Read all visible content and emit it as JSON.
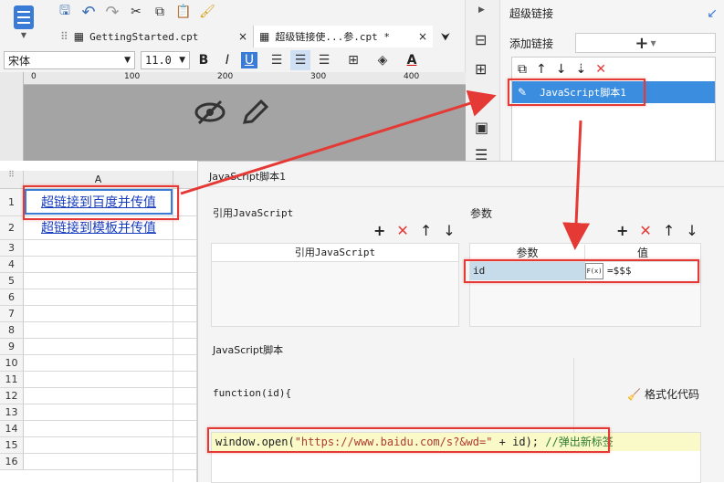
{
  "toolbar": {
    "tabs": [
      {
        "label": "GettingStarted.cpt",
        "close": "×"
      },
      {
        "label": "超级链接使...参.cpt *",
        "close": "×"
      }
    ],
    "font_name": "宋体",
    "font_size": "11.0",
    "bold": "B",
    "italic": "I",
    "underline": "U",
    "font_color_glyph": "A"
  },
  "ruler": {
    "marks": [
      "0",
      "100",
      "200",
      "300",
      "400"
    ]
  },
  "sheet": {
    "col_header": "A",
    "cell_a1": "超链接到百度并传值",
    "cell_a2": "超链接到模板并传值",
    "rows": [
      "1",
      "2",
      "3",
      "4",
      "5",
      "6",
      "7",
      "8",
      "9",
      "10",
      "11",
      "12",
      "13",
      "14",
      "15",
      "16"
    ]
  },
  "right_panel": {
    "title": "超级链接",
    "add_label": "添加链接",
    "add_btn": "+",
    "item": "JavaScript脚本1"
  },
  "dialog": {
    "title": "JavaScript脚本1",
    "ref_js_section": "引用JavaScript",
    "ref_js_col": "引用JavaScript",
    "params_section": "参数",
    "param_col": "参数",
    "value_col": "值",
    "param_name": "id",
    "param_value": "=$$$",
    "formula_btn": "F(x)",
    "script_section": "JavaScript脚本",
    "code_line1": "function(id){",
    "code_fn": "window.open(",
    "code_str": "\"https://www.baidu.com/s?&wd=\"",
    "code_rest": " + id); ",
    "code_comment": "//弹出新标签",
    "format_btn": "格式化代码"
  },
  "colors": {
    "accent": "#3a7bd5",
    "red": "#e53935",
    "selected": "#3b8de0"
  }
}
